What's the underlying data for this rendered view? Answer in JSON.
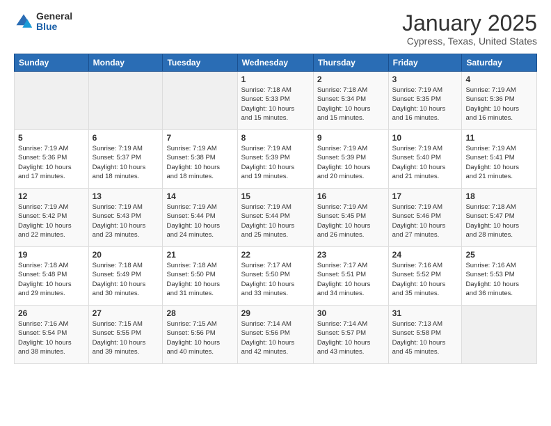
{
  "logo": {
    "general": "General",
    "blue": "Blue"
  },
  "header": {
    "title": "January 2025",
    "subtitle": "Cypress, Texas, United States"
  },
  "weekdays": [
    "Sunday",
    "Monday",
    "Tuesday",
    "Wednesday",
    "Thursday",
    "Friday",
    "Saturday"
  ],
  "weeks": [
    [
      {
        "day": "",
        "info": ""
      },
      {
        "day": "",
        "info": ""
      },
      {
        "day": "",
        "info": ""
      },
      {
        "day": "1",
        "info": "Sunrise: 7:18 AM\nSunset: 5:33 PM\nDaylight: 10 hours\nand 15 minutes."
      },
      {
        "day": "2",
        "info": "Sunrise: 7:18 AM\nSunset: 5:34 PM\nDaylight: 10 hours\nand 15 minutes."
      },
      {
        "day": "3",
        "info": "Sunrise: 7:19 AM\nSunset: 5:35 PM\nDaylight: 10 hours\nand 16 minutes."
      },
      {
        "day": "4",
        "info": "Sunrise: 7:19 AM\nSunset: 5:36 PM\nDaylight: 10 hours\nand 16 minutes."
      }
    ],
    [
      {
        "day": "5",
        "info": "Sunrise: 7:19 AM\nSunset: 5:36 PM\nDaylight: 10 hours\nand 17 minutes."
      },
      {
        "day": "6",
        "info": "Sunrise: 7:19 AM\nSunset: 5:37 PM\nDaylight: 10 hours\nand 18 minutes."
      },
      {
        "day": "7",
        "info": "Sunrise: 7:19 AM\nSunset: 5:38 PM\nDaylight: 10 hours\nand 18 minutes."
      },
      {
        "day": "8",
        "info": "Sunrise: 7:19 AM\nSunset: 5:39 PM\nDaylight: 10 hours\nand 19 minutes."
      },
      {
        "day": "9",
        "info": "Sunrise: 7:19 AM\nSunset: 5:39 PM\nDaylight: 10 hours\nand 20 minutes."
      },
      {
        "day": "10",
        "info": "Sunrise: 7:19 AM\nSunset: 5:40 PM\nDaylight: 10 hours\nand 21 minutes."
      },
      {
        "day": "11",
        "info": "Sunrise: 7:19 AM\nSunset: 5:41 PM\nDaylight: 10 hours\nand 21 minutes."
      }
    ],
    [
      {
        "day": "12",
        "info": "Sunrise: 7:19 AM\nSunset: 5:42 PM\nDaylight: 10 hours\nand 22 minutes."
      },
      {
        "day": "13",
        "info": "Sunrise: 7:19 AM\nSunset: 5:43 PM\nDaylight: 10 hours\nand 23 minutes."
      },
      {
        "day": "14",
        "info": "Sunrise: 7:19 AM\nSunset: 5:44 PM\nDaylight: 10 hours\nand 24 minutes."
      },
      {
        "day": "15",
        "info": "Sunrise: 7:19 AM\nSunset: 5:44 PM\nDaylight: 10 hours\nand 25 minutes."
      },
      {
        "day": "16",
        "info": "Sunrise: 7:19 AM\nSunset: 5:45 PM\nDaylight: 10 hours\nand 26 minutes."
      },
      {
        "day": "17",
        "info": "Sunrise: 7:19 AM\nSunset: 5:46 PM\nDaylight: 10 hours\nand 27 minutes."
      },
      {
        "day": "18",
        "info": "Sunrise: 7:18 AM\nSunset: 5:47 PM\nDaylight: 10 hours\nand 28 minutes."
      }
    ],
    [
      {
        "day": "19",
        "info": "Sunrise: 7:18 AM\nSunset: 5:48 PM\nDaylight: 10 hours\nand 29 minutes."
      },
      {
        "day": "20",
        "info": "Sunrise: 7:18 AM\nSunset: 5:49 PM\nDaylight: 10 hours\nand 30 minutes."
      },
      {
        "day": "21",
        "info": "Sunrise: 7:18 AM\nSunset: 5:50 PM\nDaylight: 10 hours\nand 31 minutes."
      },
      {
        "day": "22",
        "info": "Sunrise: 7:17 AM\nSunset: 5:50 PM\nDaylight: 10 hours\nand 33 minutes."
      },
      {
        "day": "23",
        "info": "Sunrise: 7:17 AM\nSunset: 5:51 PM\nDaylight: 10 hours\nand 34 minutes."
      },
      {
        "day": "24",
        "info": "Sunrise: 7:16 AM\nSunset: 5:52 PM\nDaylight: 10 hours\nand 35 minutes."
      },
      {
        "day": "25",
        "info": "Sunrise: 7:16 AM\nSunset: 5:53 PM\nDaylight: 10 hours\nand 36 minutes."
      }
    ],
    [
      {
        "day": "26",
        "info": "Sunrise: 7:16 AM\nSunset: 5:54 PM\nDaylight: 10 hours\nand 38 minutes."
      },
      {
        "day": "27",
        "info": "Sunrise: 7:15 AM\nSunset: 5:55 PM\nDaylight: 10 hours\nand 39 minutes."
      },
      {
        "day": "28",
        "info": "Sunrise: 7:15 AM\nSunset: 5:56 PM\nDaylight: 10 hours\nand 40 minutes."
      },
      {
        "day": "29",
        "info": "Sunrise: 7:14 AM\nSunset: 5:56 PM\nDaylight: 10 hours\nand 42 minutes."
      },
      {
        "day": "30",
        "info": "Sunrise: 7:14 AM\nSunset: 5:57 PM\nDaylight: 10 hours\nand 43 minutes."
      },
      {
        "day": "31",
        "info": "Sunrise: 7:13 AM\nSunset: 5:58 PM\nDaylight: 10 hours\nand 45 minutes."
      },
      {
        "day": "",
        "info": ""
      }
    ]
  ]
}
